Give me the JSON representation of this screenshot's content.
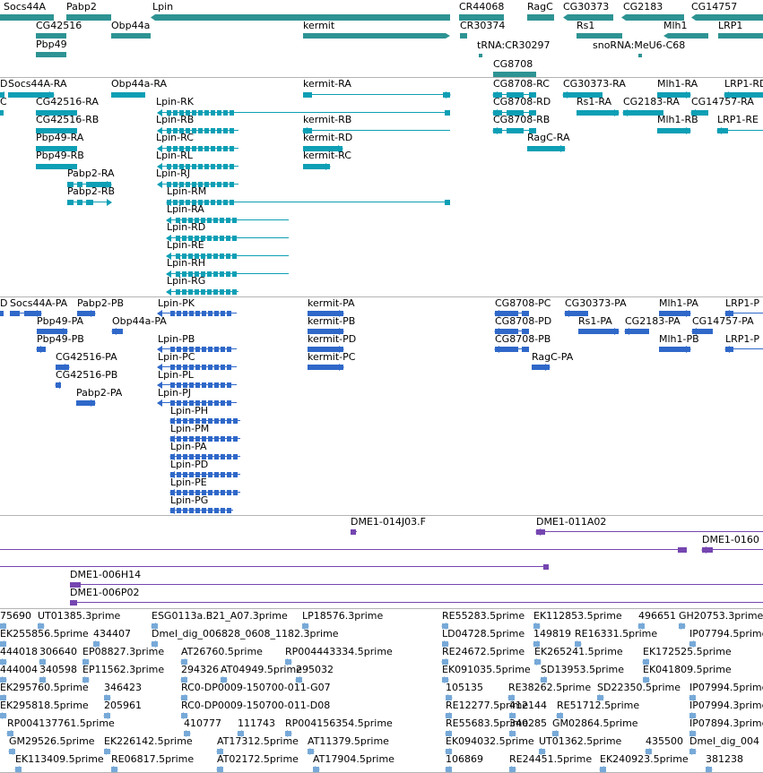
{
  "colors": {
    "gene": "#2e9393",
    "transcript": "#0d9fb5",
    "protein": "#2f68c9",
    "clone": "#7546b0",
    "est": "#77a9d8",
    "separator": "#b4b4b4"
  },
  "tracks": {
    "genes": {
      "features": [
        {
          "label": "Socs44A"
        },
        {
          "label": "Pabp2"
        },
        {
          "label": "Lpin"
        },
        {
          "label": "CR44068"
        },
        {
          "label": "RagC"
        },
        {
          "label": "CG30373"
        },
        {
          "label": "CG2183"
        },
        {
          "label": "CG14757"
        },
        {
          "label": "CG42516"
        },
        {
          "label": "Obp44a"
        },
        {
          "label": "kermit"
        },
        {
          "label": "CR30374"
        },
        {
          "label": "Rs1"
        },
        {
          "label": "Mlh1"
        },
        {
          "label": "LRP1"
        },
        {
          "label": "Pbp49"
        },
        {
          "label": "tRNA:CR30297"
        },
        {
          "label": "snoRNA:MeU6-C68"
        },
        {
          "label": "CG8708"
        }
      ]
    },
    "transcripts": {
      "features": [
        {
          "label": "D"
        },
        {
          "label": "Socs44A-RA"
        },
        {
          "label": "Obp44a-RA"
        },
        {
          "label": "kermit-RA"
        },
        {
          "label": "CG8708-RC"
        },
        {
          "label": "CG30373-RA"
        },
        {
          "label": "Mlh1-RA"
        },
        {
          "label": "LRP1-RD"
        },
        {
          "label": "C"
        },
        {
          "label": "CG42516-RA"
        },
        {
          "label": "Lpin-RK"
        },
        {
          "label": "CG8708-RD"
        },
        {
          "label": "Rs1-RA"
        },
        {
          "label": "CG2183-RA"
        },
        {
          "label": "CG14757-RA"
        },
        {
          "label": "CG42516-RB"
        },
        {
          "label": "Lpin-RB"
        },
        {
          "label": "kermit-RB"
        },
        {
          "label": "CG8708-RB"
        },
        {
          "label": "Mlh1-RB"
        },
        {
          "label": "LRP1-RE"
        },
        {
          "label": "Pbp49-RA"
        },
        {
          "label": "Lpin-RC"
        },
        {
          "label": "kermit-RD"
        },
        {
          "label": "RagC-RA"
        },
        {
          "label": "Pbp49-RB"
        },
        {
          "label": "Lpin-RL"
        },
        {
          "label": "kermit-RC"
        },
        {
          "label": "Pabp2-RA"
        },
        {
          "label": "Lpin-RJ"
        },
        {
          "label": "Pabp2-RB"
        },
        {
          "label": "Lpin-RM"
        },
        {
          "label": "Lpin-RA"
        },
        {
          "label": "Lpin-RD"
        },
        {
          "label": "Lpin-RE"
        },
        {
          "label": "Lpin-RH"
        },
        {
          "label": "Lpin-RG"
        }
      ]
    },
    "proteins": {
      "features": [
        {
          "label": "D"
        },
        {
          "label": "Socs44A-PA"
        },
        {
          "label": "Pabp2-PB"
        },
        {
          "label": "Lpin-PK"
        },
        {
          "label": "kermit-PA"
        },
        {
          "label": "CG8708-PC"
        },
        {
          "label": "CG30373-PA"
        },
        {
          "label": "Mlh1-PA"
        },
        {
          "label": "LRP1-P"
        },
        {
          "label": "Pbp49-PA"
        },
        {
          "label": "Obp44a-PA"
        },
        {
          "label": "kermit-PB"
        },
        {
          "label": "CG8708-PD"
        },
        {
          "label": "Rs1-PA"
        },
        {
          "label": "CG2183-PA"
        },
        {
          "label": "CG14757-PA"
        },
        {
          "label": "Pbp49-PB"
        },
        {
          "label": "Lpin-PB"
        },
        {
          "label": "kermit-PD"
        },
        {
          "label": "CG8708-PB"
        },
        {
          "label": "Mlh1-PB"
        },
        {
          "label": "LRP1-P"
        },
        {
          "label": "CG42516-PA"
        },
        {
          "label": "Lpin-PC"
        },
        {
          "label": "kermit-PC"
        },
        {
          "label": "RagC-PA"
        },
        {
          "label": "CG42516-PB"
        },
        {
          "label": "Lpin-PL"
        },
        {
          "label": "Pabp2-PA"
        },
        {
          "label": "Lpin-PJ"
        },
        {
          "label": "Lpin-PH"
        },
        {
          "label": "Lpin-PM"
        },
        {
          "label": "Lpin-PA"
        },
        {
          "label": "Lpin-PD"
        },
        {
          "label": "Lpin-PE"
        },
        {
          "label": "Lpin-PG"
        }
      ]
    },
    "clones": {
      "features": [
        {
          "label": "DME1-014J03.F"
        },
        {
          "label": "DME1-011A02"
        },
        {
          "label": "DME1-0160"
        },
        {
          "label": "DME1-006H14"
        },
        {
          "label": "DME1-006P02"
        }
      ]
    },
    "ests": {
      "features": [
        {
          "label": "75690"
        },
        {
          "label": "UT01385.3prime"
        },
        {
          "label": "ESG0113a.B21_A07.3prime"
        },
        {
          "label": "LP18576.3prime"
        },
        {
          "label": "RE55283.5prime"
        },
        {
          "label": "EK112853.5prime"
        },
        {
          "label": "496651"
        },
        {
          "label": "GH20753.3prime"
        },
        {
          "label": "EK255856.5prime"
        },
        {
          "label": "434407"
        },
        {
          "label": "Dmel_dig_006828_0608_1182.3prime"
        },
        {
          "label": "LD04728.5prime"
        },
        {
          "label": "149819"
        },
        {
          "label": "RE16331.5prime"
        },
        {
          "label": "IP07794.5prime"
        },
        {
          "label": "444018"
        },
        {
          "label": "306640"
        },
        {
          "label": "EP08827.3prime"
        },
        {
          "label": "AT26760.5prime"
        },
        {
          "label": "RP004443334.5prime"
        },
        {
          "label": "RE24672.5prime"
        },
        {
          "label": "EK265241.5prime"
        },
        {
          "label": "EK172525.5prime"
        },
        {
          "label": "444004"
        },
        {
          "label": "340598"
        },
        {
          "label": "EP11562.3prime"
        },
        {
          "label": "294326"
        },
        {
          "label": "AT04949.5prime"
        },
        {
          "label": "295032"
        },
        {
          "label": "EK091035.5prime"
        },
        {
          "label": "SD13953.5prime"
        },
        {
          "label": "EK041809.5prime"
        },
        {
          "label": "EK295760.5prime"
        },
        {
          "label": "346423"
        },
        {
          "label": "RC0-DP0009-150700-011-G07"
        },
        {
          "label": "105135"
        },
        {
          "label": "RE38262.5prime"
        },
        {
          "label": "SD22350.5prime"
        },
        {
          "label": "IP07994.5prime"
        },
        {
          "label": "EK295818.5prime"
        },
        {
          "label": "205961"
        },
        {
          "label": "RC0-DP0009-150700-011-D08"
        },
        {
          "label": "RE12277.5prime"
        },
        {
          "label": "412144"
        },
        {
          "label": "RE51712.5prime"
        },
        {
          "label": "IP07994.3prime"
        },
        {
          "label": "RP004137761.5prime"
        },
        {
          "label": "410777"
        },
        {
          "label": "111743"
        },
        {
          "label": "RP004156354.5prime"
        },
        {
          "label": "RE55683.5prime"
        },
        {
          "label": "340285"
        },
        {
          "label": "GM02864.5prime"
        },
        {
          "label": "IP07894.3prime"
        },
        {
          "label": "GM29526.5prime"
        },
        {
          "label": "EK226142.5prime"
        },
        {
          "label": "AT17312.5prime"
        },
        {
          "label": "AT11379.5prime"
        },
        {
          "label": "EK094032.5prime"
        },
        {
          "label": "UT01362.5prime"
        },
        {
          "label": "435500"
        },
        {
          "label": "Dmel_dig_004"
        },
        {
          "label": "EK113409.5prime"
        },
        {
          "label": "RE06817.5prime"
        },
        {
          "label": "AT02172.5prime"
        },
        {
          "label": "AT17904.5prime"
        },
        {
          "label": "106869"
        },
        {
          "label": "RE24451.5prime"
        },
        {
          "label": "EK240923.5prime"
        },
        {
          "label": "381238"
        }
      ]
    }
  }
}
